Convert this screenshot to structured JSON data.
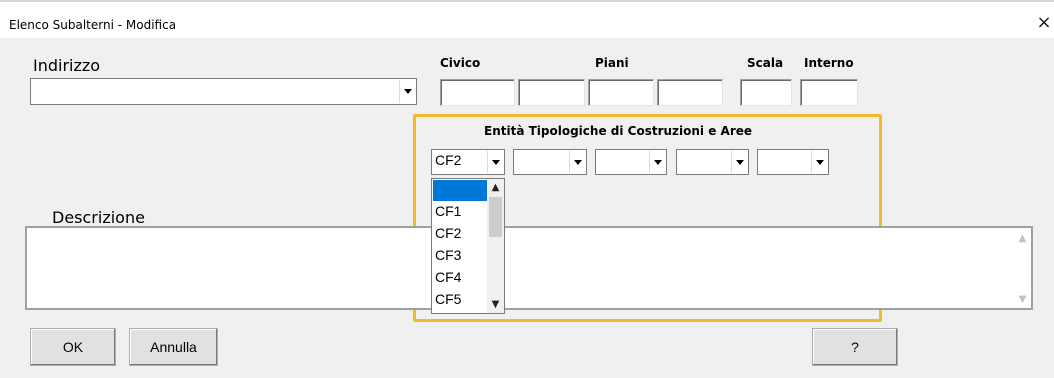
{
  "window": {
    "title": "Elenco Subalterni - Modifica",
    "close_glyph": "×"
  },
  "labels": {
    "indirizzo": "Indirizzo",
    "civico": "Civico",
    "piani": "Piani",
    "scala": "Scala",
    "interno": "Interno",
    "entita": "Entità Tipologiche di Costruzioni e Aree",
    "descrizione": "Descrizione"
  },
  "fields": {
    "indirizzo_value": "",
    "civico_value": "",
    "piani_values": [
      "",
      "",
      ""
    ],
    "scala_value": "",
    "interno_value": ""
  },
  "entita_combos": [
    "CF2",
    "",
    "",
    "",
    ""
  ],
  "dropdown": {
    "open_for": 0,
    "options": [
      "",
      "CF1",
      "CF2",
      "CF3",
      "CF4",
      "CF5"
    ],
    "selected_index": 0
  },
  "descrizione_value": "",
  "buttons": {
    "ok": "OK",
    "annulla": "Annulla",
    "help": "?"
  },
  "icons": {
    "combo_arrow": "triangle-down-icon",
    "scroll_up": "chevron-up-icon",
    "scroll_down": "chevron-down-icon"
  },
  "colors": {
    "highlight": "#f7b731",
    "selection": "#0078d7"
  }
}
